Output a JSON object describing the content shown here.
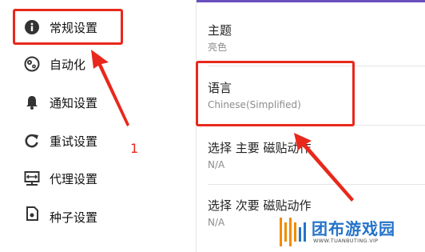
{
  "sidebar": {
    "items": [
      {
        "label": "常规设置",
        "icon": "info-icon"
      },
      {
        "label": "自动化",
        "icon": "automation-gear-icon"
      },
      {
        "label": "通知设置",
        "icon": "bell-icon"
      },
      {
        "label": "重试设置",
        "icon": "retry-icon"
      },
      {
        "label": "代理设置",
        "icon": "proxy-network-icon"
      },
      {
        "label": "种子设置",
        "icon": "seed-file-icon"
      }
    ]
  },
  "settings": [
    {
      "title": "主题",
      "value": "亮色"
    },
    {
      "title": "语言",
      "value": "Chinese(Simplified)"
    },
    {
      "title": "选择 主要 磁贴动作",
      "value": "N/A"
    },
    {
      "title": "选择 次要 磁贴动作",
      "value": "N/A"
    }
  ],
  "annotation": {
    "number": "1"
  },
  "watermark": {
    "name": "团布游戏园",
    "url": "WWW.TUANBUTING.VIP"
  },
  "colors": {
    "annotation": "#e8281c",
    "accent": "#6a4fbf",
    "watermark": "#2473c9"
  }
}
